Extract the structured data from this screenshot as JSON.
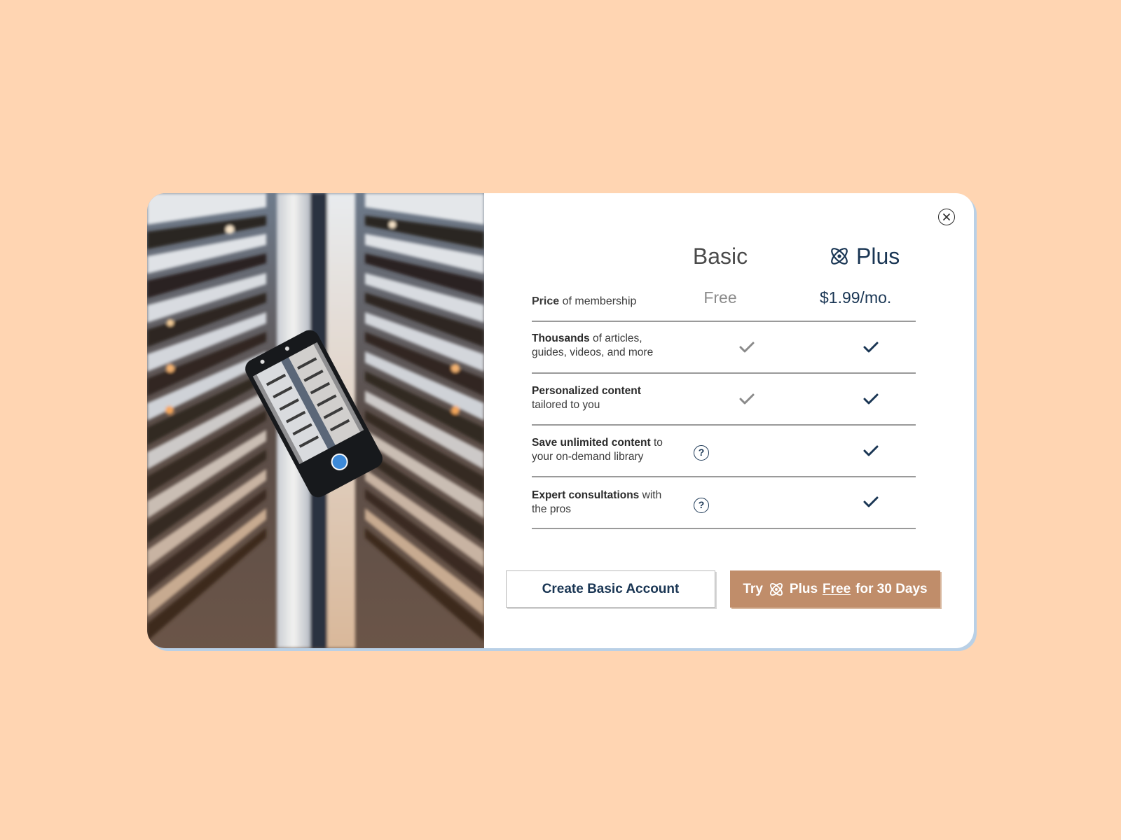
{
  "close": {
    "label": "×"
  },
  "columns": {
    "basic": "Basic",
    "plus": "Plus"
  },
  "price": {
    "label_bold": "Price",
    "label_rest": " of membership",
    "basic": "Free",
    "plus": "$1.99/mo."
  },
  "features": [
    {
      "bold": "Thousands",
      "rest_line1": " of articles,",
      "line2": "guides, videos, and more",
      "basic": true,
      "plus": true,
      "help": false
    },
    {
      "bold": "Personalized content",
      "rest_line1": "",
      "line2": "tailored to you",
      "basic": true,
      "plus": true,
      "help": false
    },
    {
      "bold": "Save unlimited content",
      "rest_line1": " to",
      "line2": "your on-demand library",
      "basic": false,
      "plus": true,
      "help": true
    },
    {
      "bold": "Expert consultations",
      "rest_line1": " with",
      "line2": "the pros",
      "basic": false,
      "plus": true,
      "help": true
    }
  ],
  "help_icon": {
    "glyph": "?"
  },
  "buttons": {
    "basic": "Create Basic Account",
    "plus_try": "Try",
    "plus_name": "Plus",
    "plus_free": "Free",
    "plus_rest": "for 30 Days"
  },
  "icons": {
    "close": "close-icon",
    "atom": "atom-icon",
    "check": "check-icon",
    "help": "question-circle-icon"
  },
  "colors": {
    "background": "#FFD5B2",
    "navy": "#1a3654",
    "check_basic": "#8a8a8a",
    "plus_button": "#C08D6A",
    "modal_shadow": "#B9D0E6"
  }
}
